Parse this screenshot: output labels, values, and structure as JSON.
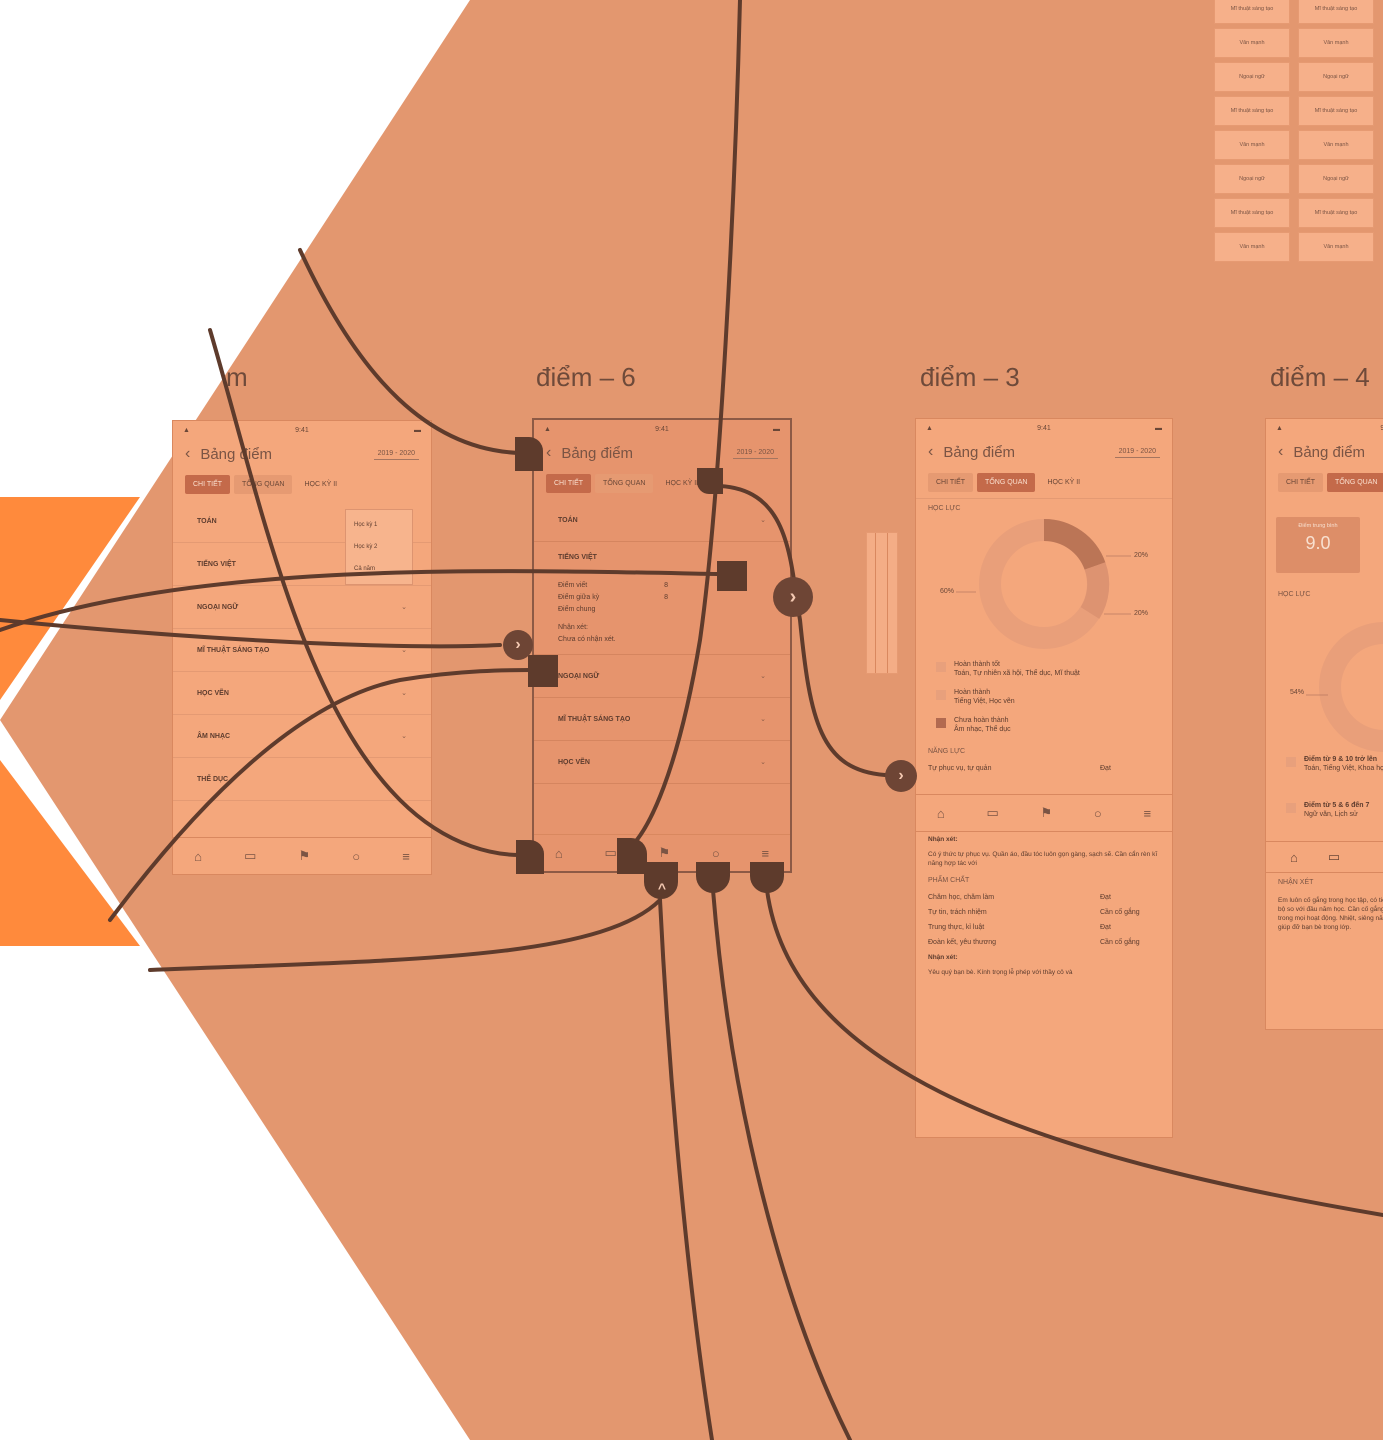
{
  "colors": {
    "overlay": "#e3976f",
    "accent": "#ff8a3c",
    "wire": "#5e3b2c",
    "screen": "#f4a77c"
  },
  "titles": {
    "screen_6": "điểm – 6",
    "screen_3": "điểm – 3",
    "screen_4": "điểm – 4",
    "screen_left": "m"
  },
  "common": {
    "header_title": "Bảng điểm",
    "year": "2019 - 2020",
    "tab_detail": "CHI TIẾT",
    "tab_overview": "TỔNG QUAN",
    "term": "HỌC KỲ II"
  },
  "left_screen": {
    "subjects": [
      "TOÁN",
      "TIẾNG VIỆT",
      "NGOẠI NGỮ",
      "MĨ THUẬT SÁNG TẠO",
      "HỌC VẼN",
      "ÂM NHẠC",
      "THỂ DỤC"
    ],
    "dropdown": [
      "Học kỳ 1",
      "Học kỳ 2",
      "Cả năm"
    ]
  },
  "screen_6": {
    "subjects_top": [
      "TOÁN",
      "TIẾNG VIỆT"
    ],
    "details": [
      {
        "label": "Điểm viết",
        "value": "8"
      },
      {
        "label": "Điểm giữa kỳ",
        "value": "8"
      },
      {
        "label": "Điểm chung",
        "value": ""
      }
    ],
    "note_label": "Nhận xét:",
    "note_text": "Chưa có nhận xét.",
    "subjects_bottom": [
      "NGOẠI NGỮ",
      "MĨ THUẬT SÁNG TẠO",
      "HỌC VẼN"
    ]
  },
  "screen_3": {
    "section_hoc_luc": "HỌC LỰC",
    "pct_left": "60%",
    "pct_top_right": "20%",
    "pct_bottom_right": "20%",
    "legend": [
      {
        "title": "Hoàn thành tốt",
        "desc": "Toán, Tự nhiên xã hội, Thể dục, Mĩ thuật"
      },
      {
        "title": "Hoàn thành",
        "desc": "Tiếng Việt, Học vẽn"
      },
      {
        "title": "Chưa hoàn thành",
        "desc": "Âm nhạc, Thể dục"
      }
    ],
    "section_nang_luc": "NĂNG LỰC",
    "nang_luc": [
      {
        "label": "Tự phục vụ, tự quản",
        "value": "Đạt"
      }
    ],
    "note_label": "Nhận xét:",
    "note_text": "Có ý thức tự phục vụ. Quần áo, đầu tóc luôn gọn gàng, sạch sẽ. Cần cẩn rèn kĩ năng hợp tác với",
    "section_pham_chat": "PHẨM CHẤT",
    "pham_chat": [
      {
        "label": "Chăm học, chăm làm",
        "value": "Đạt"
      },
      {
        "label": "Tự tin, trách nhiệm",
        "value": "Cần cố gắng"
      },
      {
        "label": "Trung thực, kỉ luật",
        "value": "Đạt"
      },
      {
        "label": "Đoàn kết, yêu thương",
        "value": "Cần cố gắng"
      }
    ],
    "note2_label": "Nhận xét:",
    "note2_text": "Yêu quý bạn bè. Kính trọng lễ phép với thầy cô và"
  },
  "screen_4": {
    "score_label": "Điểm trung bình",
    "score": "9.0",
    "section_hoc_luc": "HỌC LỰC",
    "pct_left": "54%",
    "legend": [
      {
        "title": "Điểm từ 9 & 10 trở lên",
        "desc": "Toán, Tiếng Việt, Khoa học"
      },
      {
        "title": "Điểm từ 5 & 6 đến 7",
        "desc": "Ngữ văn, Lịch sử"
      }
    ],
    "section_nhan_xet": "NHẬN XÉT",
    "note_text": "Em luôn cố gắng trong học tập, có tiến bộ so với đầu năm học. Cần cố gắng trong mọi hoạt động. Nhiệt, siêng năng giúp đỡ bạn bè trong lớp."
  },
  "cards": [
    [
      "Mĩ thuật sáng tạo",
      "Mĩ thuật sáng tạo"
    ],
    [
      "Văn mạnh",
      "Văn mạnh"
    ],
    [
      "Ngoại ngữ",
      "Ngoại ngữ"
    ],
    [
      "Mĩ thuật sáng tạo",
      "Mĩ thuật sáng tạo"
    ],
    [
      "Văn mạnh",
      "Văn mạnh"
    ],
    [
      "Ngoại ngữ",
      "Ngoại ngữ"
    ],
    [
      "Mĩ thuật sáng tạo",
      "Mĩ thuật sáng tạo"
    ],
    [
      "Văn mạnh",
      "Văn mạnh"
    ]
  ]
}
